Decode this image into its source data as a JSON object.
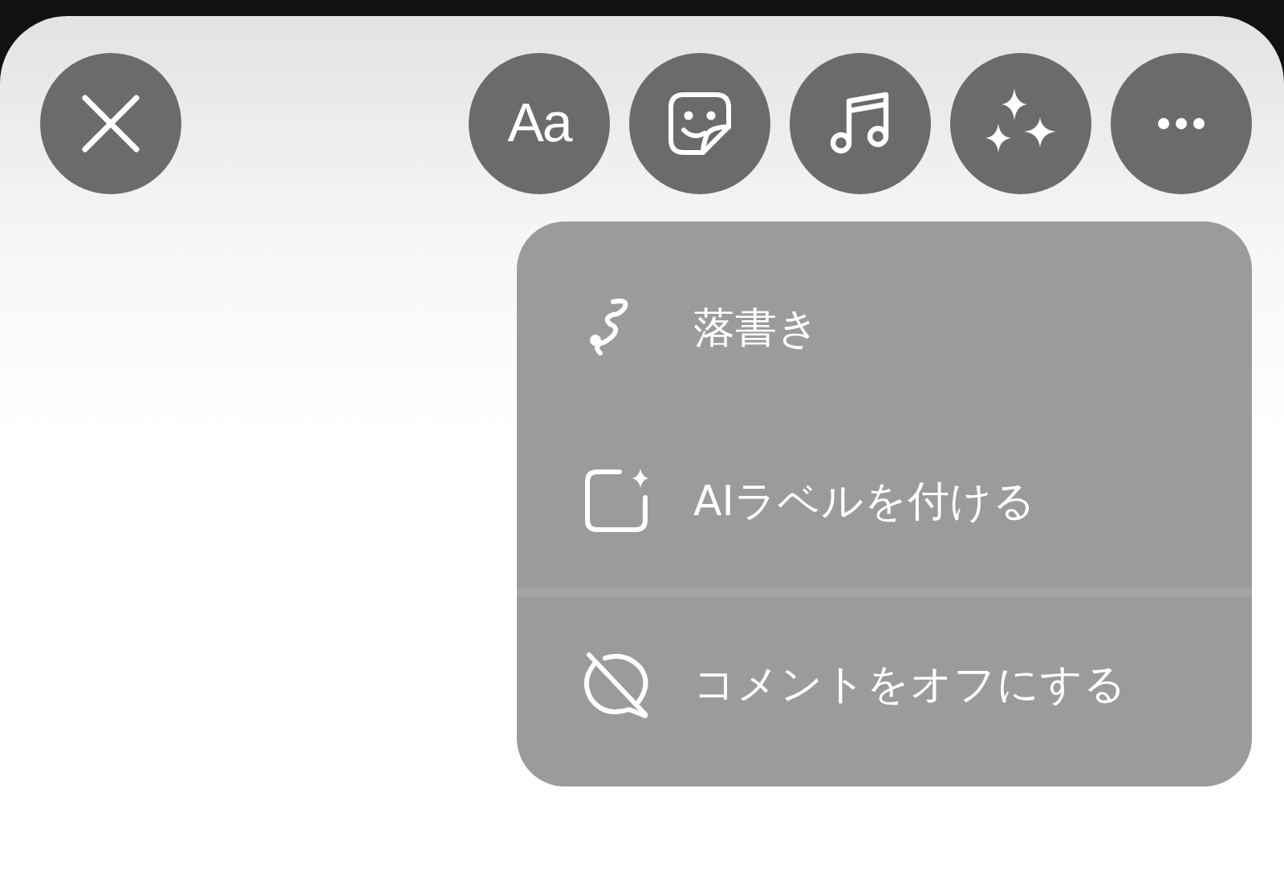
{
  "toolbar": {
    "close_button": {
      "kind": "close"
    },
    "buttons": [
      {
        "kind": "text",
        "label": "Aa"
      },
      {
        "kind": "sticker"
      },
      {
        "kind": "music"
      },
      {
        "kind": "sparkles"
      },
      {
        "kind": "more"
      }
    ]
  },
  "menu": {
    "sections": [
      [
        {
          "kind": "draw",
          "label": "落書き"
        },
        {
          "kind": "ai-label",
          "label": "AIラベルを付ける"
        }
      ],
      [
        {
          "kind": "comments-off",
          "label": "コメントをオフにする"
        }
      ]
    ]
  }
}
